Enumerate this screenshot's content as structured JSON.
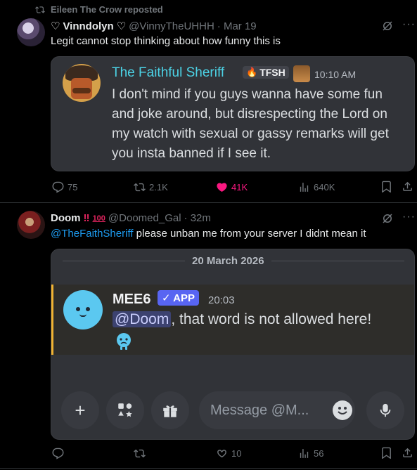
{
  "tweet1": {
    "repost_text": "Eileen The Crow reposted",
    "display_name": "Vinndolyn",
    "handle": "@VinnyTheUHHH",
    "date": "· Mar 19",
    "text": "Legit cannot stop thinking about how funny this is",
    "embed": {
      "author": "The Faithful Sheriff",
      "tag": "TFSH",
      "time": "10:10 AM",
      "message": "I don't mind if you guys wanna have some fun and joke around, but disrespecting the Lord on my watch with sexual or gassy remarks will get you insta banned if I see it."
    },
    "replies": "75",
    "reposts": "2.1K",
    "likes": "41K",
    "views": "640K"
  },
  "tweet2": {
    "display_name": "Doom",
    "handle": "@Doomed_Gal",
    "date": "· 32m",
    "mention": "@TheFaithSheriff",
    "text": " please unban me from your server I didnt mean it",
    "embed": {
      "date_divider": "20 March 2026",
      "bot_name": "MEE6",
      "bot_badge": "✓ APP",
      "time": "20:03",
      "mention": "@Doom",
      "message": ", that word is not allowed here!",
      "input_placeholder": "Message @M..."
    },
    "replies": "",
    "reposts": "",
    "likes": "10",
    "views": "56"
  },
  "colors": {
    "like_pink": "#f91880",
    "link_blue": "#1d9bf0",
    "sheriff_cyan": "#4cd3e6",
    "discord_blurple": "#5865f2",
    "highlight_bar": "#f0b232"
  }
}
